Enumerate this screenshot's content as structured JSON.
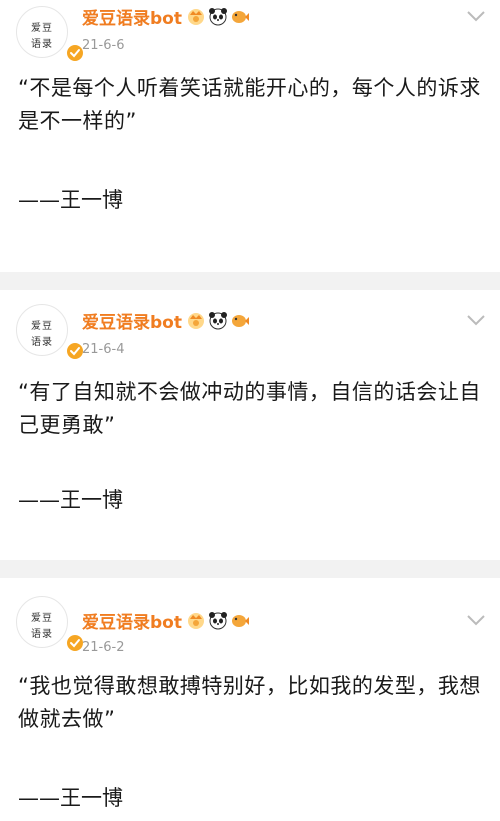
{
  "posts": [
    {
      "account_name": "爱豆语录bot",
      "avatar_text": [
        "爱豆",
        "语录"
      ],
      "date": "21-6-6",
      "quote": "“不是每个人听着笑话就能开心的，每个人的诉求是不一样的”",
      "author": "——王一博"
    },
    {
      "account_name": "爱豆语录bot",
      "avatar_text": [
        "爱豆",
        "语录"
      ],
      "date": "21-6-4",
      "quote": "“有了自知就不会做冲动的事情，自信的话会让自己更勇敢”",
      "author": "——王一博"
    },
    {
      "account_name": "爱豆语录bot",
      "avatar_text": [
        "爱豆",
        "语录"
      ],
      "date": "21-6-2",
      "quote": "“我也觉得敢想敢搏特别好，比如我的发型，我想做就去做”",
      "author": "——王一博"
    }
  ],
  "colors": {
    "account_name": "#f07d21",
    "date": "#999999",
    "verified_badge": "#f6a623",
    "feed_background": "#f2f2f2",
    "card_background": "#ffffff"
  },
  "icons": [
    "verified-badge-icon",
    "crown-badge-icon",
    "panda-badge-icon",
    "fish-badge-icon",
    "chevron-down-icon"
  ]
}
